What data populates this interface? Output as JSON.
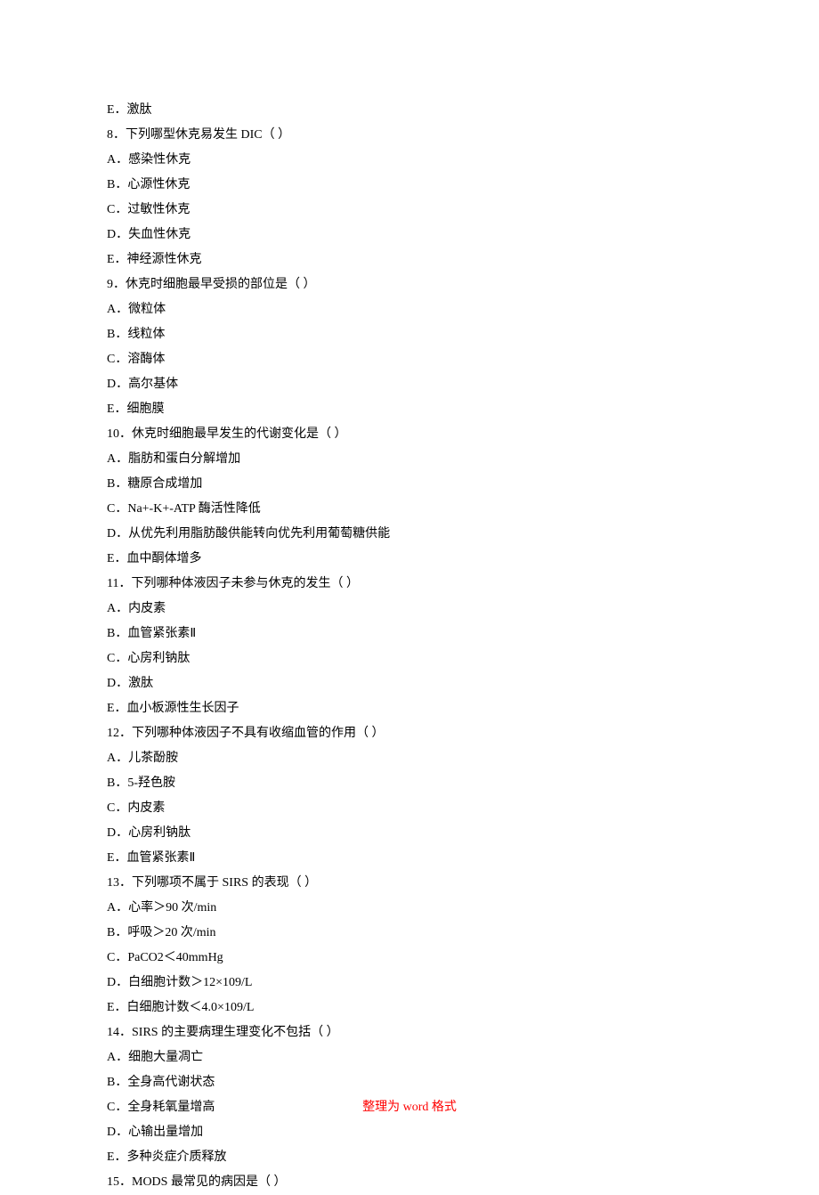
{
  "lines": [
    "E．激肽",
    "8．下列哪型休克易发生 DIC（ ）",
    "A．感染性休克",
    "B．心源性休克",
    "C．过敏性休克",
    "D．失血性休克",
    "E．神经源性休克",
    "9．休克时细胞最早受损的部位是（ ）",
    "A．微粒体",
    "B．线粒体",
    "C．溶酶体",
    "D．高尔基体",
    "E．细胞膜",
    "10．休克时细胞最早发生的代谢变化是（ ）",
    "A．脂肪和蛋白分解增加",
    "B．糖原合成增加",
    "C．Na+-K+-ATP 酶活性降低",
    "D．从优先利用脂肪酸供能转向优先利用葡萄糖供能",
    "E．血中酮体增多",
    "11．下列哪种体液因子未参与休克的发生（ ）",
    "A．内皮素",
    "B．血管紧张素Ⅱ",
    "C．心房利钠肽",
    "D．激肽",
    "E．血小板源性生长因子",
    "12．下列哪种体液因子不具有收缩血管的作用（ ）",
    "A．儿茶酚胺",
    "B．5-羟色胺",
    "C．内皮素",
    "D．心房利钠肽",
    "E．血管紧张素Ⅱ",
    "13．下列哪项不属于 SIRS 的表现（ ）",
    "A．心率＞90 次/min",
    "B．呼吸＞20 次/min",
    "C．PaCO2＜40mmHg",
    "D．白细胞计数＞12×109/L",
    "E．白细胞计数＜4.0×109/L",
    "14．SIRS 的主要病理生理变化不包括（ ）",
    "A．细胞大量凋亡",
    "B．全身高代谢状态",
    "C．全身耗氧量增高",
    "D．心输出量增加",
    "E．多种炎症介质释放",
    "15．MODS 最常见的病因是（ ）"
  ],
  "footer": {
    "part1": "整理为",
    "part2": " word ",
    "part3": "格式"
  }
}
